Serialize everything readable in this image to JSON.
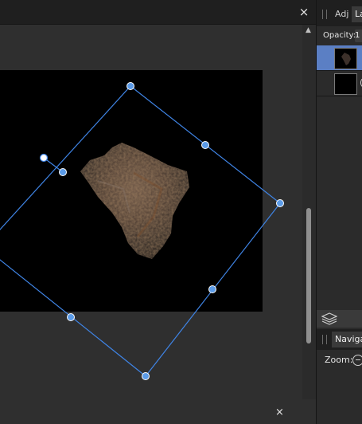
{
  "document_tab": {
    "close_glyph": "×"
  },
  "canvas": {
    "background": "#2f2f2f",
    "document_background": "#000000",
    "transform_box_color": "#3f84e5",
    "handle_fill": "#5b9be8",
    "rotation_handle_fill": "#ffffff"
  },
  "bottom_bar": {
    "close_glyph": "×"
  },
  "layers_panel": {
    "tabs": [
      {
        "label": "Adj",
        "active": false
      },
      {
        "label": "La",
        "active": true
      }
    ],
    "opacity_label": "Opacity:",
    "opacity_value": "1",
    "layers": [
      {
        "name": "",
        "selected": true,
        "thumbnail": "rock-image"
      },
      {
        "name": "(",
        "selected": false,
        "thumbnail": "black-fill"
      }
    ],
    "selection_color": "#5b7fc4"
  },
  "navigator_panel": {
    "tab_label": "Naviga",
    "zoom_label": "Zoom:"
  }
}
